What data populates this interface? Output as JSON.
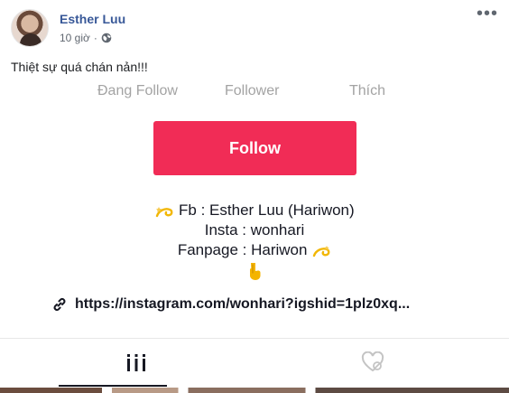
{
  "post": {
    "author": "Esther Luu",
    "time": "10 giờ",
    "separator": "·",
    "caption": "Thiệt sự quá chán nản!!!"
  },
  "profile": {
    "stats": [
      "Đang Follow",
      "Follower",
      "Thích"
    ],
    "follow_label": "Follow",
    "bio": {
      "fb": "Fb : Esther Luu (Hariwon)",
      "insta": "Insta : wonhari",
      "fanpage": "Fanpage : Hariwon"
    },
    "link": "https://instagram.com/wonhari?igshid=1plz0xq..."
  },
  "icons": {
    "globe": "globe-icon",
    "more": "more-options-icon",
    "dizzy": "dizzy-emoji-icon",
    "point_down": "point-down-emoji-icon",
    "link": "link-icon",
    "grid": "videos-grid-icon",
    "liked": "liked-videos-icon"
  },
  "colors": {
    "author": "#385898",
    "follow_button": "#f12c56",
    "stats": "#a3a3a3"
  }
}
